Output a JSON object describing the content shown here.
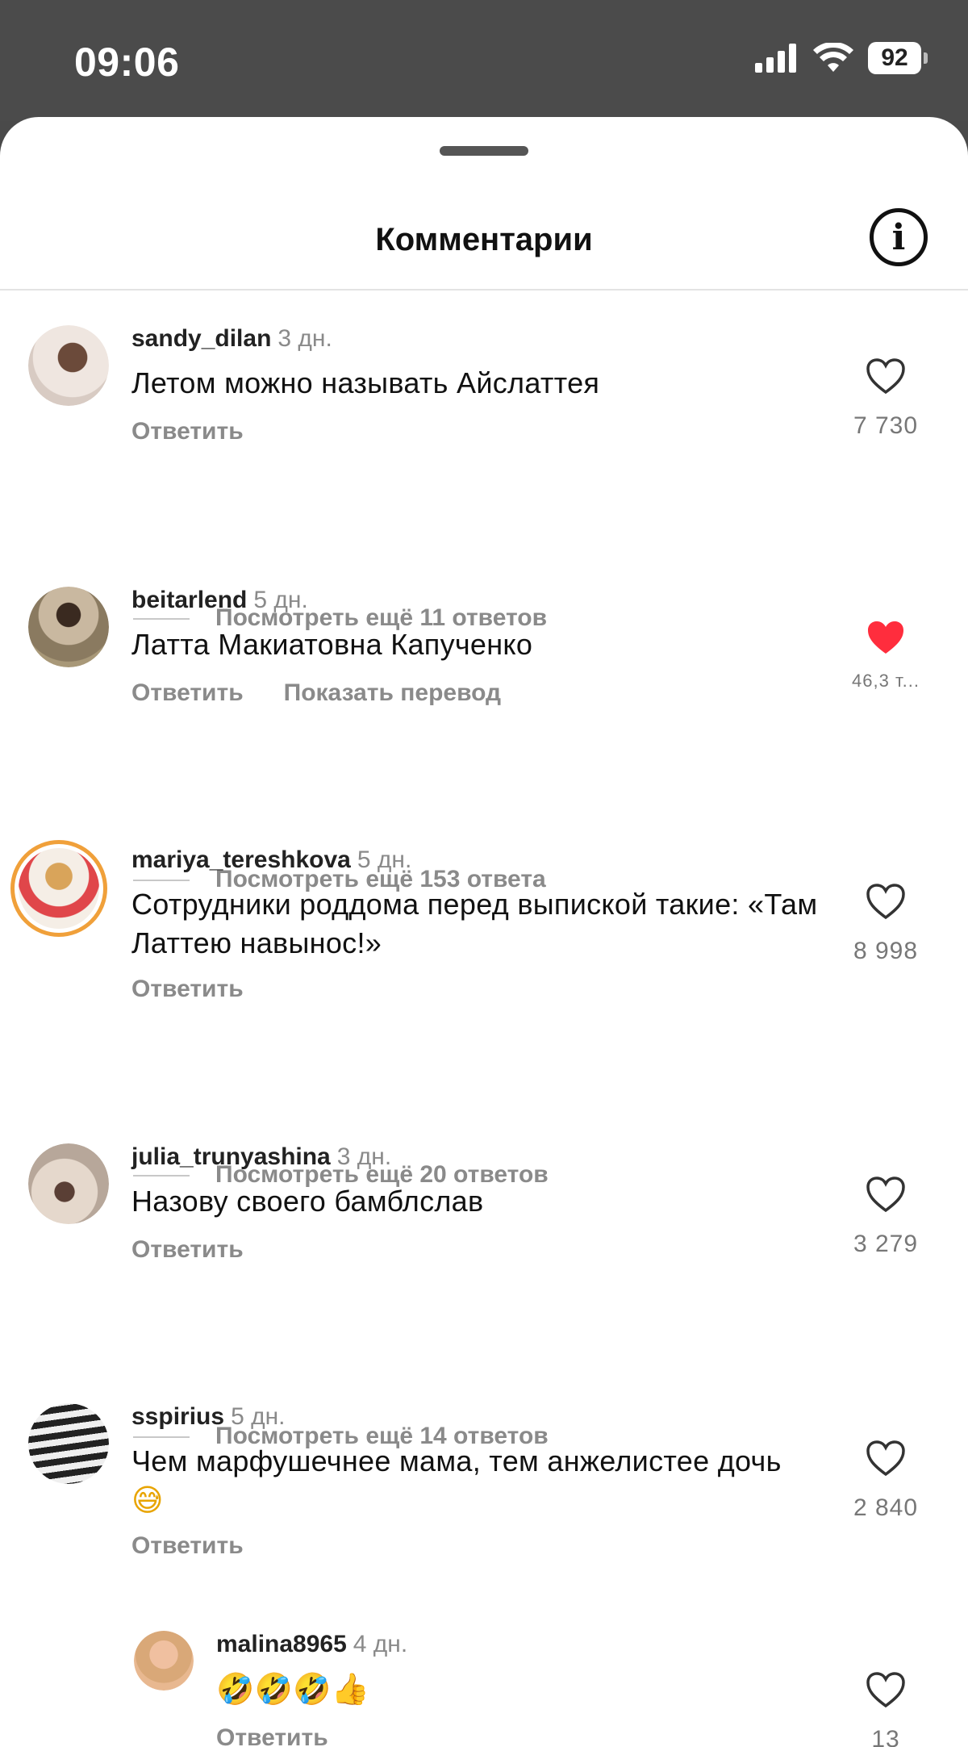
{
  "status_bar": {
    "time": "09:06",
    "battery": "92"
  },
  "sheet": {
    "title": "Комментарии",
    "info_icon": "info-icon"
  },
  "comments": [
    {
      "user": "sandy_dilan",
      "time": "3 дн.",
      "text": "Летом можно называть Айслаттея",
      "reply": "Ответить",
      "likes": "7 730",
      "liked": false,
      "more_replies": "Посмотреть ещё 11 ответов"
    },
    {
      "user": "beitarlend",
      "time": "5 дн.",
      "text": "Латта Макиатовна Капученко",
      "reply": "Ответить",
      "translate": "Показать перевод",
      "likes": "46,3 т...",
      "liked": true,
      "more_replies": "Посмотреть ещё 153 ответа"
    },
    {
      "user": "mariya_tereshkova",
      "time": "5 дн.",
      "text": "Сотрудники роддома перед выпиской такие: «Там Латтею навынос!»",
      "reply": "Ответить",
      "likes": "8 998",
      "liked": false,
      "more_replies": "Посмотреть ещё 20 ответов"
    },
    {
      "user": "julia_trunyashina",
      "time": "3 дн.",
      "text": "Назову своего бамблслав",
      "reply": "Ответить",
      "likes": "3 279",
      "liked": false,
      "more_replies": "Посмотреть ещё 14 ответов"
    },
    {
      "user": "sspirius",
      "time": "5 дн.",
      "text": "Чем марфушечнее мама, тем анжелистее дочь",
      "emoji": "😅",
      "reply": "Ответить",
      "likes": "2 840",
      "liked": false
    },
    {
      "user": "malina8965",
      "time": "4 дн.",
      "emoji": "🤣🤣🤣👍",
      "reply": "Ответить",
      "likes": "13",
      "liked": false
    }
  ],
  "colors": {
    "liked_heart": "#ff2d3d",
    "muted_text": "#8a8a8a",
    "story_ring": "#f0a03a"
  }
}
